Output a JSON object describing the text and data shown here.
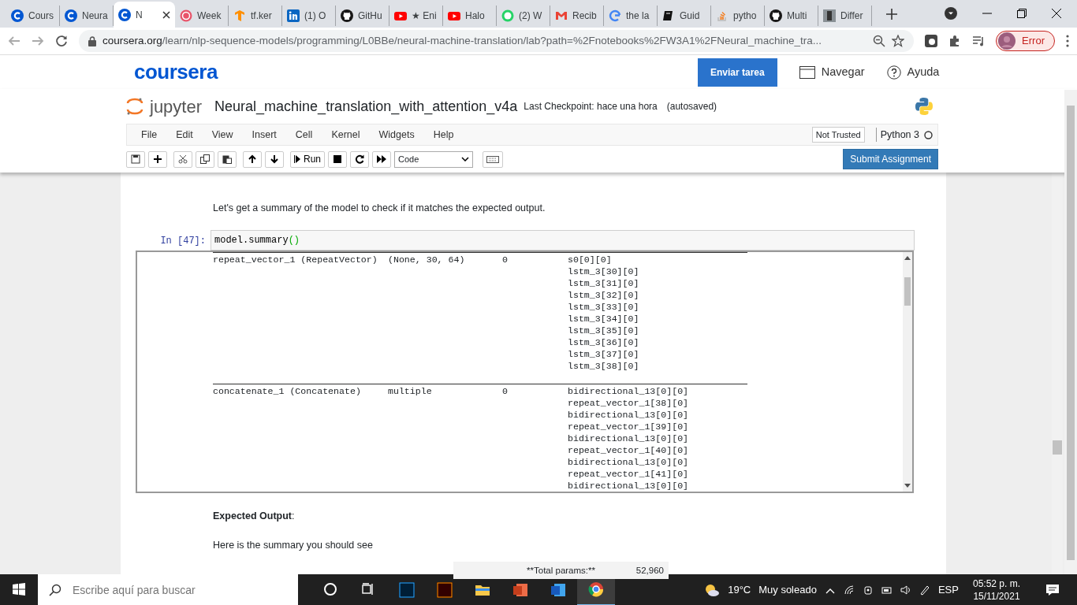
{
  "browser": {
    "tabs": [
      {
        "title": "Cours",
        "selected": false
      },
      {
        "title": "Neura",
        "selected": false
      },
      {
        "title": "N",
        "selected": true
      },
      {
        "title": "Week",
        "selected": false
      },
      {
        "title": "tf.ker",
        "selected": false
      },
      {
        "title": "(1) O",
        "selected": false
      },
      {
        "title": "GitHu",
        "selected": false
      },
      {
        "title": "★ Eni",
        "selected": false
      },
      {
        "title": "Halo",
        "selected": false
      },
      {
        "title": "(2) W",
        "selected": false
      },
      {
        "title": "Recib",
        "selected": false
      },
      {
        "title": "the la",
        "selected": false
      },
      {
        "title": "Guid",
        "selected": false
      },
      {
        "title": "pytho",
        "selected": false
      },
      {
        "title": "Multi",
        "selected": false
      },
      {
        "title": "Differ",
        "selected": false
      }
    ],
    "url_host": "coursera.org",
    "url_path": "/learn/nlp-sequence-models/programming/L0BBe/neural-machine-translation/lab?path=%2Fnotebooks%2FW3A1%2FNeural_machine_tra...",
    "profile_status": "Error"
  },
  "coursera": {
    "logo": "coursera",
    "submit_button": "Enviar tarea",
    "links": [
      "Navegar",
      "Ayuda"
    ]
  },
  "jupyter": {
    "logo": "jupyter",
    "notebook_name": "Neural_machine_translation_with_attention_v4a",
    "checkpoint": "Last Checkpoint: hace una hora",
    "autosave": "(autosaved)",
    "menu": [
      "File",
      "Edit",
      "View",
      "Insert",
      "Cell",
      "Kernel",
      "Widgets",
      "Help"
    ],
    "trust": "Not Trusted",
    "kernel": "Python 3",
    "run_label": "Run",
    "cell_type": "Code",
    "submit_button": "Submit Assignment"
  },
  "notebook": {
    "intro": "Let's get a summary of the model to check if it matches the expected output.",
    "cell": {
      "prompt": "In [47]:",
      "code": [
        {
          "text": "model.summary",
          "kind": "name"
        },
        {
          "text": "()",
          "kind": "paren"
        }
      ]
    },
    "output_rows": [
      {
        "layer": "repeat_vector_1 (RepeatVector)",
        "shape": "(None, 30, 64)",
        "params": "0",
        "connected": [
          "s0[0][0]",
          "lstm_3[30][0]",
          "lstm_3[31][0]",
          "lstm_3[32][0]",
          "lstm_3[33][0]",
          "lstm_3[34][0]",
          "lstm_3[35][0]",
          "lstm_3[36][0]",
          "lstm_3[37][0]",
          "lstm_3[38][0]"
        ]
      },
      {
        "layer": "concatenate_1 (Concatenate)",
        "shape": "multiple",
        "params": "0",
        "connected": [
          "bidirectional_13[0][0]",
          "repeat_vector_1[38][0]",
          "bidirectional_13[0][0]",
          "repeat_vector_1[39][0]",
          "bidirectional_13[0][0]",
          "repeat_vector_1[40][0]",
          "bidirectional_13[0][0]",
          "repeat_vector_1[41][0]",
          "bidirectional_13[0][0]"
        ]
      }
    ],
    "expected_heading": "**Expected Output**:",
    "expected_text": "Here is the summary you should see",
    "expected_table": [
      {
        "label": "**Total params:**",
        "value": "52,960"
      }
    ]
  },
  "taskbar": {
    "search_placeholder": "Escribe aquí para buscar",
    "temperature": "19°C",
    "weather": "Muy soleado",
    "language": "ESP",
    "time": "05:52 p. m.",
    "date": "15/11/2021"
  }
}
